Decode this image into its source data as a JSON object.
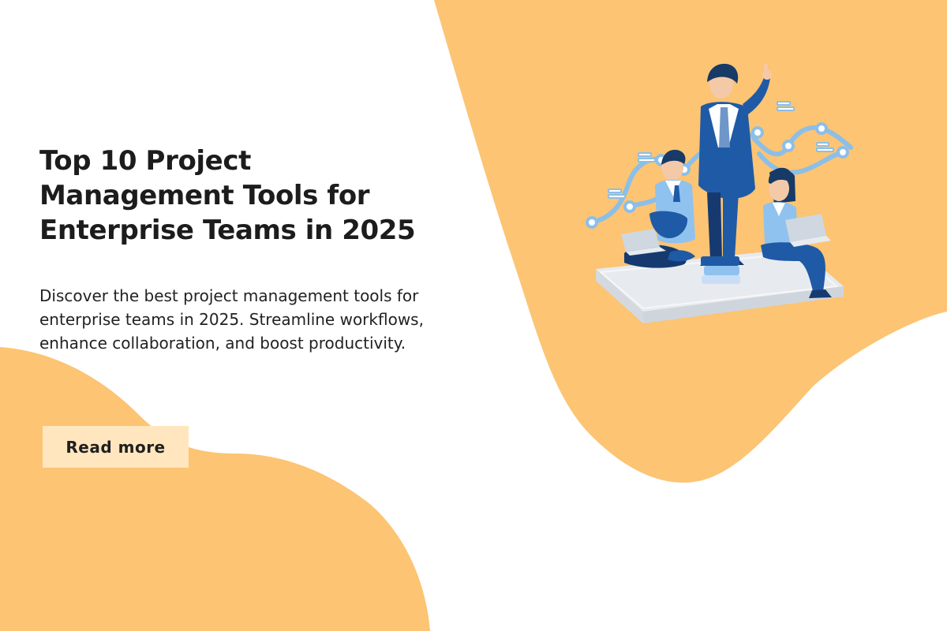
{
  "hero": {
    "headline": "Top 10 Project Management Tools for Enterprise Teams in 2025",
    "description": "Discover the best project management tools for enterprise teams in 2025. Streamline workflows, enhance collaboration, and boost productivity.",
    "cta_label": "Read more"
  },
  "illustration": {
    "subject": "team-meeting-illustration"
  },
  "colors": {
    "blob": "#fcc473",
    "cta_background": "#ffe6bf",
    "text": "#1c1c1c",
    "suit": "#1f5aa6",
    "suit_dark": "#163a70",
    "vest": "#8fc2ef",
    "skin": "#f4c9a8",
    "hair": "#173a66",
    "platform": "#dfe4ea",
    "network_line": "#8bbfe8"
  }
}
